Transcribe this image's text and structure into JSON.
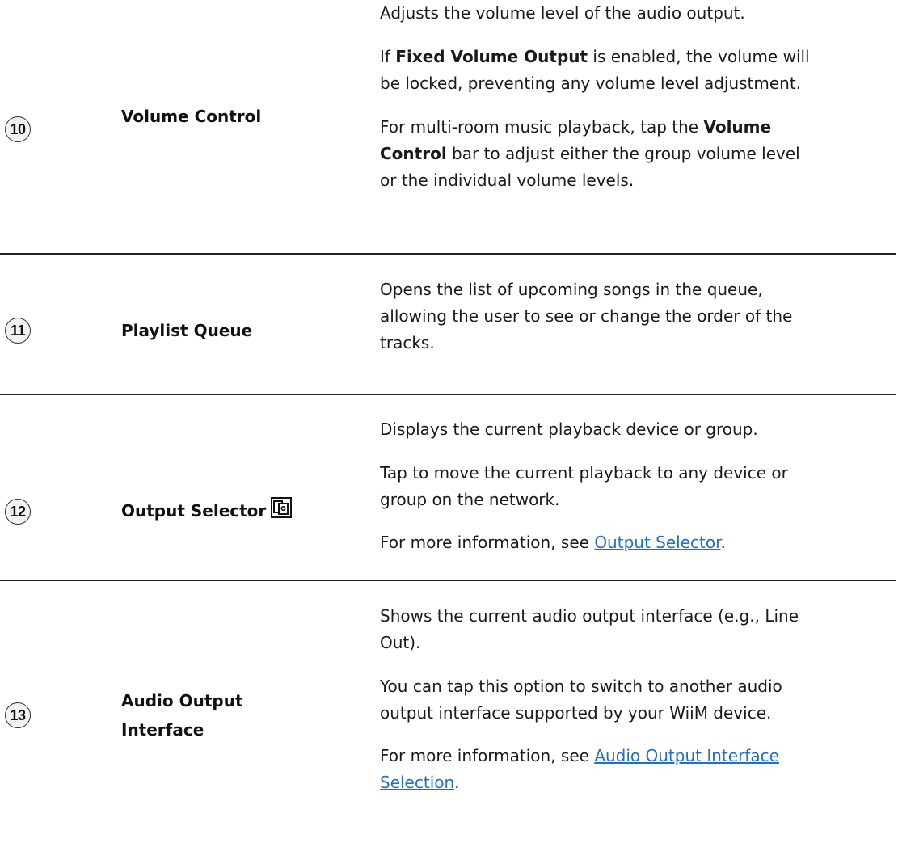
{
  "rows": [
    {
      "number": "10",
      "feature": "Volume Control",
      "lines": [
        {
          "text": "Adjusts the volume level of the audio output."
        },
        {
          "pre": "If ",
          "bold": "Fixed Volume Output",
          "post": " is enabled, the volume will"
        },
        {
          "text": "be locked, preventing any volume level adjustment."
        },
        {
          "pre": "For multi-room music playback, tap the ",
          "bold": "Volume"
        },
        {
          "bold": "Control",
          "post": " bar to adjust either the group volume level"
        },
        {
          "text": "or the individual volume levels."
        }
      ]
    },
    {
      "number": "11",
      "feature": "Playlist Queue",
      "lines": [
        {
          "text": "Opens the list of upcoming songs in the queue,"
        },
        {
          "text": "allowing the user to see or change the order of the"
        },
        {
          "text": "tracks."
        }
      ]
    },
    {
      "number": "12",
      "feature": "Output Selector",
      "feature_icon": "output-selector-icon",
      "lines": [
        {
          "text": "Displays the current playback device or group."
        },
        {
          "text": "Tap to move the current playback to any device or"
        },
        {
          "text": "group on the network."
        },
        {
          "pre": "For more information, see ",
          "link": "Output Selector",
          "post": "."
        }
      ]
    },
    {
      "number": "13",
      "feature_line1": "Audio Output",
      "feature_line2": "Interface",
      "lines": [
        {
          "text": "Shows the current audio output interface (e.g., Line"
        },
        {
          "text": "Out)."
        },
        {
          "text": "You can tap this option to switch to another audio"
        },
        {
          "text": "output interface supported by your WiiM device."
        },
        {
          "pre": "For more information, see ",
          "link": "Audio Output Interface "
        },
        {
          "link": "Selection",
          "post": "."
        }
      ]
    }
  ],
  "colors": {
    "link": "#1d6fc7",
    "divider": "#222222",
    "text": "#1a1a1a"
  }
}
